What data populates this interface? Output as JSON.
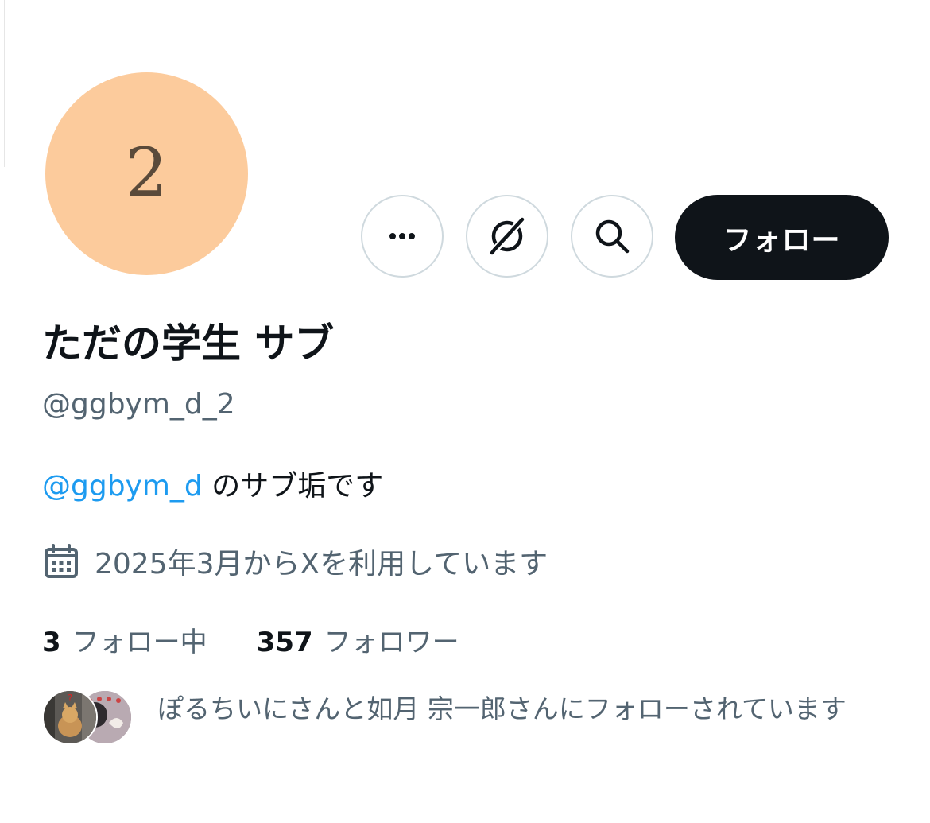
{
  "profile": {
    "avatar_text": "2",
    "avatar_color": "#fccb9c",
    "display_name": "ただの学生 サブ",
    "handle": "@ggbym_d_2",
    "bio_mention": "@ggbym_d",
    "bio_text": " のサブ垢です",
    "joined": "2025年3月からXを利用しています",
    "following_count": "3",
    "following_label": "フォロー中",
    "followers_count": "357",
    "followers_label": "フォロワー",
    "followed_by_text": "ぽるちいにさんと如月 宗一郎さんにフォローされています"
  },
  "actions": {
    "more_icon": "more-icon",
    "grok_icon": "grok-icon",
    "search_icon": "search-icon",
    "follow_label": "フォロー"
  },
  "colors": {
    "accent": "#1d9bf0",
    "primary_text": "#0f1419",
    "secondary_text": "#536471",
    "follow_button_bg": "#0f1419"
  }
}
